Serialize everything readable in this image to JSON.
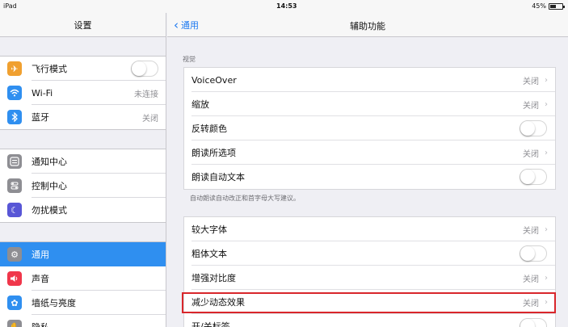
{
  "status": {
    "device": "iPad",
    "time": "14:53",
    "battery": "45%",
    "battery_level": 0.45
  },
  "left": {
    "title": "设置",
    "groups": [
      [
        {
          "label": "飞行模式",
          "icon": "airplane-icon",
          "color": "#f0a030",
          "type": "toggle"
        },
        {
          "label": "Wi-Fi",
          "icon": "wifi-icon",
          "color": "#2f8ff0",
          "value": "未连接"
        },
        {
          "label": "蓝牙",
          "icon": "bluetooth-icon",
          "color": "#2f8ff0",
          "value": "关闭"
        }
      ],
      [
        {
          "label": "通知中心",
          "icon": "notification-icon",
          "color": "#8e8e93"
        },
        {
          "label": "控制中心",
          "icon": "control-center-icon",
          "color": "#8e8e93"
        },
        {
          "label": "勿扰模式",
          "icon": "moon-icon",
          "color": "#5856d6"
        }
      ],
      [
        {
          "label": "通用",
          "icon": "gear-icon",
          "color": "#8e8e93",
          "selected": true
        },
        {
          "label": "声音",
          "icon": "speaker-icon",
          "color": "#f0364a"
        },
        {
          "label": "墙纸与亮度",
          "icon": "flower-icon",
          "color": "#2f8ff0"
        },
        {
          "label": "隐私",
          "icon": "hand-icon",
          "color": "#8e8e93"
        }
      ]
    ]
  },
  "right": {
    "back_label": "通用",
    "title": "辅助功能",
    "section_label": "视觉",
    "group1": [
      {
        "label": "VoiceOver",
        "value": "关闭",
        "type": "link"
      },
      {
        "label": "缩放",
        "value": "关闭",
        "type": "link"
      },
      {
        "label": "反转颜色",
        "type": "toggle"
      },
      {
        "label": "朗读所选项",
        "value": "关闭",
        "type": "link"
      },
      {
        "label": "朗读自动文本",
        "type": "toggle"
      }
    ],
    "note": "自动朗读自动改正和首字母大写建议。",
    "group2": [
      {
        "label": "较大字体",
        "value": "关闭",
        "type": "link"
      },
      {
        "label": "粗体文本",
        "type": "toggle"
      },
      {
        "label": "增强对比度",
        "value": "关闭",
        "type": "link"
      },
      {
        "label": "减少动态效果",
        "value": "关闭",
        "type": "link"
      },
      {
        "label": "开/关标签",
        "type": "toggle"
      }
    ]
  }
}
